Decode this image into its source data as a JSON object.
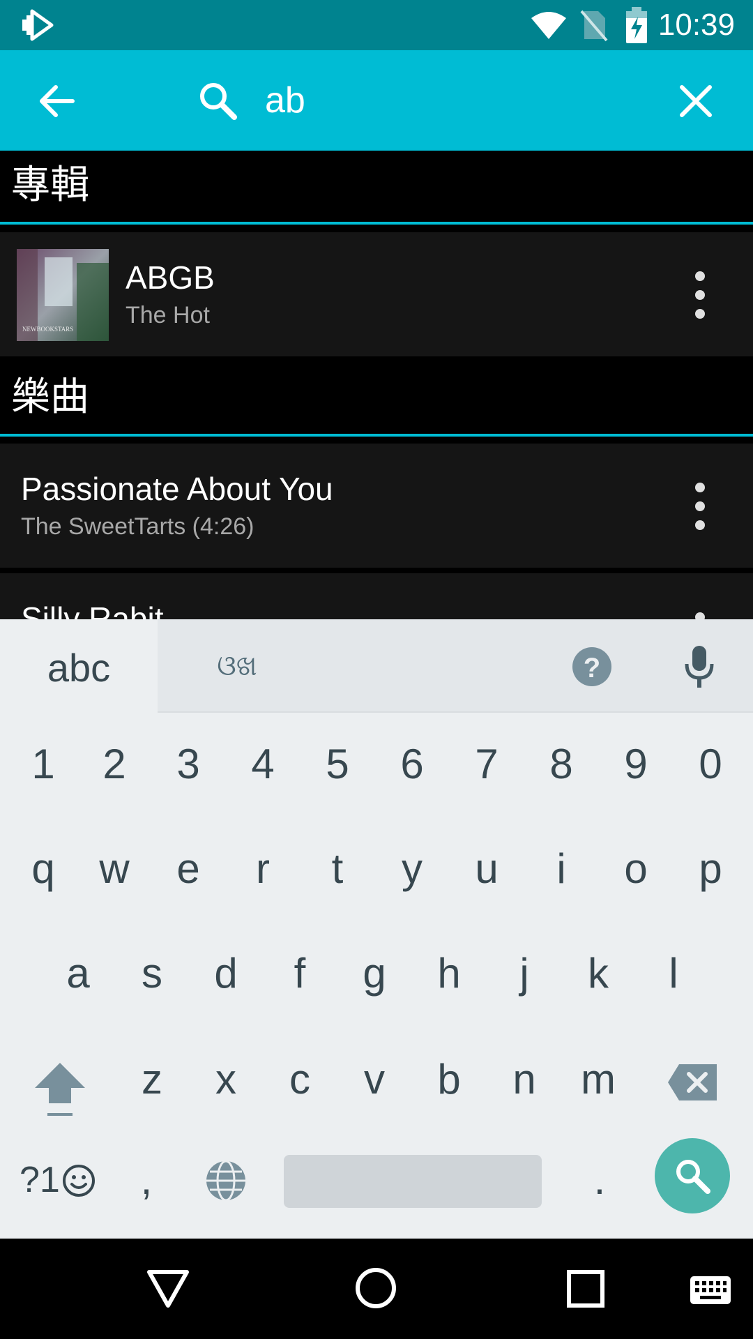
{
  "status_bar": {
    "time": "10:39"
  },
  "search": {
    "query": "ab"
  },
  "sections": {
    "albums": {
      "title": "專輯",
      "items": [
        {
          "title": "ABGB",
          "subtitle": "The Hot",
          "art_text": "NEWBOOKSTARS"
        }
      ]
    },
    "songs": {
      "title": "樂曲",
      "items": [
        {
          "title": "Passionate About You",
          "subtitle": "The SweetTarts (4:26)"
        },
        {
          "title": "Silly Rabit"
        }
      ]
    }
  },
  "keyboard": {
    "tabs": {
      "abc": "abc",
      "odia": "ଓଖ"
    },
    "numbers": [
      "1",
      "2",
      "3",
      "4",
      "5",
      "6",
      "7",
      "8",
      "9",
      "0"
    ],
    "row1": [
      "q",
      "w",
      "e",
      "r",
      "t",
      "y",
      "u",
      "i",
      "o",
      "p"
    ],
    "row2": [
      "a",
      "s",
      "d",
      "f",
      "g",
      "h",
      "j",
      "k",
      "l"
    ],
    "row3": [
      "z",
      "x",
      "c",
      "v",
      "b",
      "n",
      "m"
    ],
    "symbols_label": "?1",
    "comma": ",",
    "period": "."
  },
  "colors": {
    "accent": "#00bcd4",
    "status_bar": "#00838f",
    "row_bg": "#151515",
    "keyboard_bg": "#eceff1",
    "search_fab": "#4db6ac"
  }
}
